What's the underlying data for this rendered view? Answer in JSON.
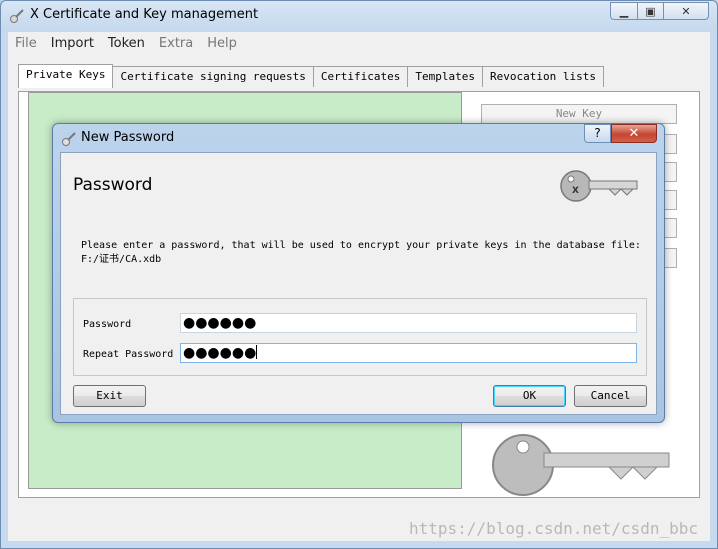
{
  "window": {
    "title": "X Certificate and Key management"
  },
  "menu": [
    {
      "label": "File",
      "enabled": false
    },
    {
      "label": "Import",
      "enabled": true
    },
    {
      "label": "Token",
      "enabled": true
    },
    {
      "label": "Extra",
      "enabled": false
    },
    {
      "label": "Help",
      "enabled": false
    }
  ],
  "tabs": [
    {
      "label": "Private Keys"
    },
    {
      "label": "Certificate signing requests"
    },
    {
      "label": "Certificates"
    },
    {
      "label": "Templates"
    },
    {
      "label": "Revocation lists"
    }
  ],
  "side_buttons": {
    "new_key": "New Key"
  },
  "watermark": "https://blog.csdn.net/csdn_bbc",
  "dialog": {
    "title": "New Password",
    "heading": "Password",
    "message_line1": "Please enter a password, that will be used to encrypt your private keys in the database file:",
    "message_line2": "F:/证书/CA.xdb",
    "password_label": "Password",
    "password_value": "●●●●●●",
    "repeat_label": "Repeat Password",
    "repeat_value": "●●●●●●",
    "exit_label": "Exit",
    "ok_label": "OK",
    "cancel_label": "Cancel",
    "help_glyph": "?",
    "close_glyph": "✕"
  }
}
